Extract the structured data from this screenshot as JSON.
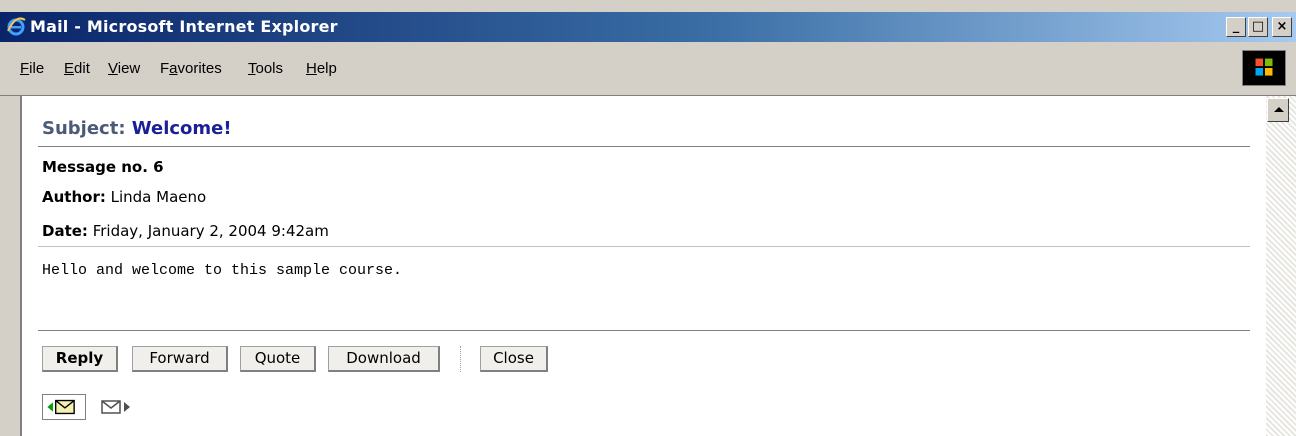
{
  "window": {
    "title": "Mail - Microsoft Internet Explorer",
    "controls": {
      "minimize": "_",
      "maximize": "□",
      "close": "×"
    }
  },
  "menu": [
    {
      "label": "File",
      "accel": "F"
    },
    {
      "label": "Edit",
      "accel": "E"
    },
    {
      "label": "View",
      "accel": "V"
    },
    {
      "label": "Favorites",
      "accel": "a"
    },
    {
      "label": "Tools",
      "accel": "T"
    },
    {
      "label": "Help",
      "accel": "H"
    }
  ],
  "message": {
    "subject_label": "Subject:",
    "subject": "Welcome!",
    "number_label": "Message no. 6",
    "author_label": "Author:",
    "author": "Linda Maeno",
    "date_label": "Date:",
    "date": "Friday, January 2, 2004 9:42am",
    "body": "Hello and welcome to this sample course."
  },
  "actions": {
    "reply": "Reply",
    "forward": "Forward",
    "quote": "Quote",
    "download": "Download",
    "close": "Close"
  },
  "icons": {
    "prev_message": "envelope-prev-icon",
    "next_message": "envelope-next-icon",
    "ie": "internet-explorer-icon",
    "windows": "windows-logo-icon"
  },
  "colors": {
    "title_bar_start": "#0a246a",
    "subject_value": "#1a1f9a",
    "subject_label": "#4a5a78",
    "chrome": "#d4d0c8"
  }
}
